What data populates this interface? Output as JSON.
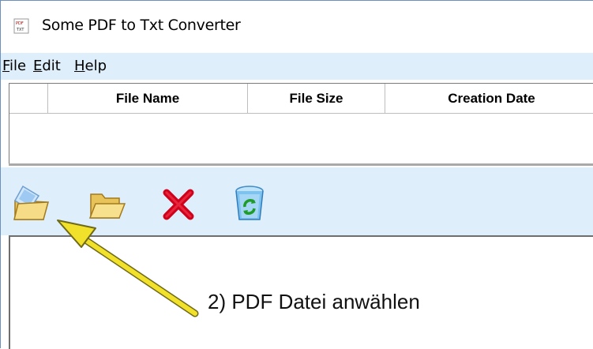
{
  "window": {
    "title": "Some PDF to Txt Converter"
  },
  "menubar": {
    "items": [
      {
        "accel": "F",
        "rest": "ile"
      },
      {
        "accel": "E",
        "rest": "dit"
      },
      {
        "accel": "H",
        "rest": "elp"
      }
    ]
  },
  "file_list": {
    "columns": [
      "",
      "File Name",
      "File Size",
      "Creation Date"
    ],
    "rows": []
  },
  "toolbar": {
    "buttons": [
      {
        "icon": "open-file-icon"
      },
      {
        "icon": "open-folder-icon"
      },
      {
        "icon": "delete-icon"
      },
      {
        "icon": "recycle-bin-icon"
      }
    ]
  },
  "annotation": {
    "text": "2) PDF Datei anwählen",
    "arrow_color": "#f2e12a"
  },
  "colors": {
    "panel_bg": "#deeefa",
    "delete_red": "#d0021b"
  }
}
